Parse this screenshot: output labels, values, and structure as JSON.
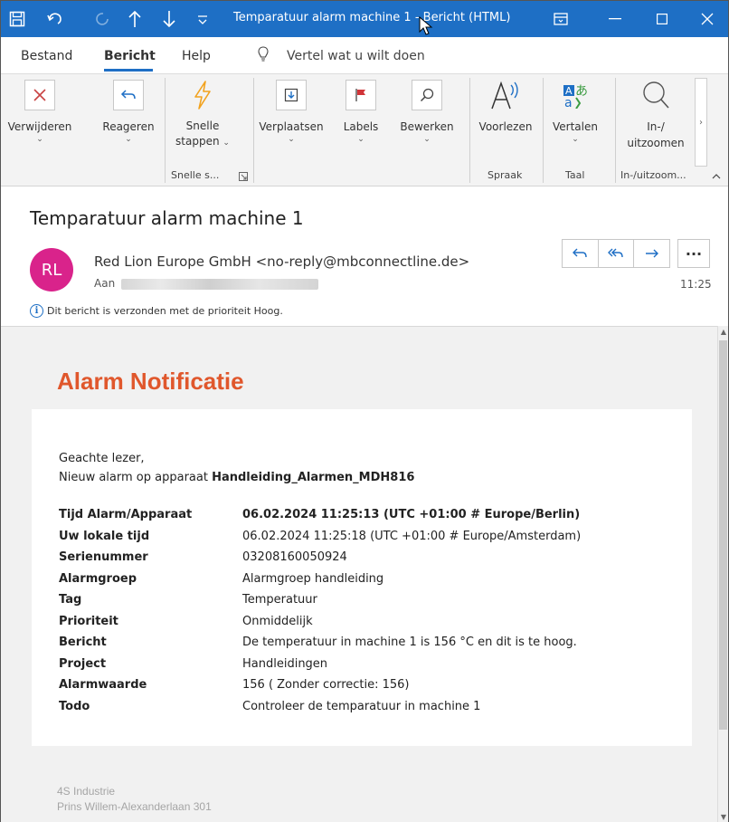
{
  "window": {
    "title": "Temparatuur alarm machine 1  -  Bericht (HTML)"
  },
  "menu": {
    "tabs": [
      "Bestand",
      "Bericht",
      "Help"
    ],
    "active_tab": "Bericht",
    "tell_me": "Vertel wat u wilt doen"
  },
  "ribbon": {
    "delete": "Verwijderen",
    "reply": "Reageren",
    "quick_steps_line1": "Snelle",
    "quick_steps_line2": "stappen",
    "move": "Verplaatsen",
    "labels": "Labels",
    "edit": "Bewerken",
    "read_aloud": "Voorlezen",
    "translate": "Vertalen",
    "zoom_line1": "In-/",
    "zoom_line2": "uitzoomen",
    "group_quick_steps": "Snelle s...",
    "group_speech": "Spraak",
    "group_language": "Taal",
    "group_zoom": "In-/uitzoom..."
  },
  "message": {
    "subject": "Temparatuur alarm machine 1",
    "avatar_initials": "RL",
    "sender": "Red Lion Europe GmbH <no-reply@mbconnectline.de>",
    "to_label": "Aan",
    "time": "11:25",
    "more": "···",
    "priority_note": "Dit bericht is verzonden met de prioriteit Hoog."
  },
  "body": {
    "title": "Alarm Notificatie",
    "greeting": "Geachte lezer,",
    "intro_prefix": "Nieuw alarm op apparaat ",
    "device": "Handleiding_Alarmen_MDH816",
    "rows": [
      {
        "key": "Tijd Alarm/Apparaat",
        "value": "06.02.2024 11:25:13 (UTC +01:00 # Europe/Berlin)"
      },
      {
        "key": "Uw lokale tijd",
        "value": "06.02.2024 11:25:18 (UTC +01:00 # Europe/Amsterdam)"
      },
      {
        "key": "Serienummer",
        "value": "03208160050924"
      },
      {
        "key": "Alarmgroep",
        "value": "Alarmgroep handleiding"
      },
      {
        "key": "Tag",
        "value": "Temperatuur"
      },
      {
        "key": "Prioriteit",
        "value": "Onmiddelijk"
      },
      {
        "key": "Bericht",
        "value": "De temperatuur in machine 1 is 156 °C en dit is te hoog."
      },
      {
        "key": "Project",
        "value": "Handleidingen"
      },
      {
        "key": "Alarmwaarde",
        "value": "156 ( Zonder correctie: 156)"
      },
      {
        "key": "Todo",
        "value": "Controleer de temparatuur in machine 1"
      }
    ],
    "footer_line1": "4S Industrie",
    "footer_line2": "Prins Willem-Alexanderlaan 301"
  },
  "colors": {
    "titlebar": "#1e6fc5",
    "avatar": "#d9238b",
    "alarm_title": "#e0572c"
  }
}
